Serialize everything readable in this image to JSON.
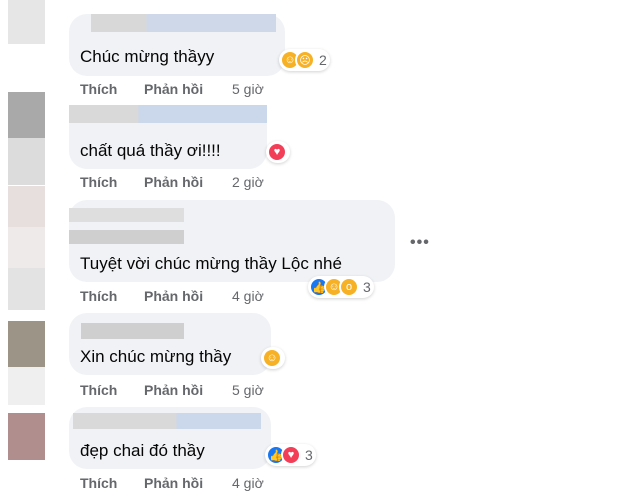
{
  "labels": {
    "like": "Thích",
    "reply": "Phản hồi"
  },
  "comments": [
    {
      "text": "Chúc mừng thầyy",
      "time": "5 giờ",
      "reaction_count": "2",
      "reactions": [
        "care-icon",
        "sad-icon"
      ]
    },
    {
      "text": "chất quá thầy ơi!!!!",
      "time": "2 giờ",
      "reaction_count": "",
      "reactions": [
        "love-icon"
      ]
    },
    {
      "text": "Tuyệt vời chúc mừng thầy Lộc nhé",
      "time": "4 giờ",
      "reaction_count": "3",
      "reactions": [
        "like-icon",
        "care-icon",
        "wow-icon"
      ]
    },
    {
      "text": "Xin chúc mừng thầy",
      "time": "5 giờ",
      "reaction_count": "",
      "reactions": [
        "care-icon"
      ]
    },
    {
      "text": "đẹp chai đó thầy",
      "time": "4 giờ",
      "reaction_count": "3",
      "reactions": [
        "like-icon",
        "love-icon"
      ]
    }
  ],
  "more_menu": "•••",
  "colors": {
    "bubble": "#f0f2f5",
    "meta_text": "#65676b",
    "like_blue": "#1877f2",
    "love_red": "#f33e58",
    "emoji_yellow": "#f7b125"
  }
}
